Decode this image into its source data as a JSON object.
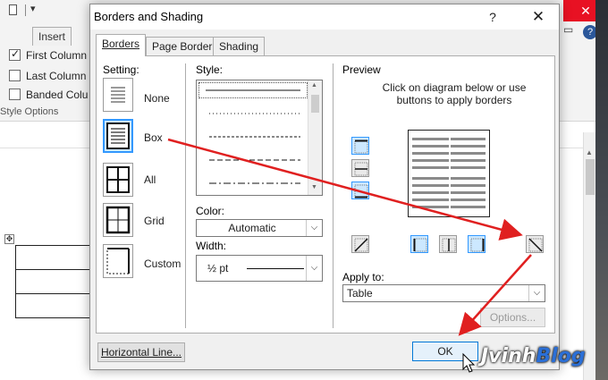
{
  "word": {
    "ribbon_tabs": [
      "Insert"
    ],
    "table_style_options": {
      "items": [
        {
          "label": "First Column",
          "checked": true
        },
        {
          "label": "Last Column",
          "checked": false
        },
        {
          "label": "Banded Colu",
          "checked": false
        }
      ],
      "group_label": "Style Options"
    }
  },
  "dialog": {
    "title": "Borders and Shading",
    "help": "?",
    "close": "✕",
    "tabs": [
      {
        "label": "Borders",
        "active": true
      },
      {
        "label": "Page Border",
        "active": false
      },
      {
        "label": "Shading",
        "active": false
      }
    ],
    "setting": {
      "heading": "Setting:",
      "options": [
        {
          "label": "None",
          "selected": false
        },
        {
          "label": "Box",
          "selected": true
        },
        {
          "label": "All",
          "selected": false
        },
        {
          "label": "Grid",
          "selected": false
        },
        {
          "label": "Custom",
          "selected": false
        }
      ]
    },
    "style": {
      "heading": "Style:",
      "lines": [
        "solid",
        "dotted",
        "dashed",
        "long-dash",
        "dash-dot"
      ]
    },
    "color": {
      "heading": "Color:",
      "value": "Automatic"
    },
    "width": {
      "heading": "Width:",
      "value": "½ pt"
    },
    "preview": {
      "heading": "Preview",
      "instruction_line1": "Click on diagram below or use",
      "instruction_line2": "buttons to apply borders"
    },
    "apply_to": {
      "heading": "Apply to:",
      "value": "Table"
    },
    "buttons": {
      "options": "Options...",
      "horizontal_line": "Horizontal Line...",
      "ok": "OK"
    }
  },
  "watermark": {
    "part1": "Jvinh",
    "part2": "Blog"
  },
  "colors": {
    "accent": "#3399ff",
    "annotation": "#e02020",
    "close_red": "#e81123"
  }
}
